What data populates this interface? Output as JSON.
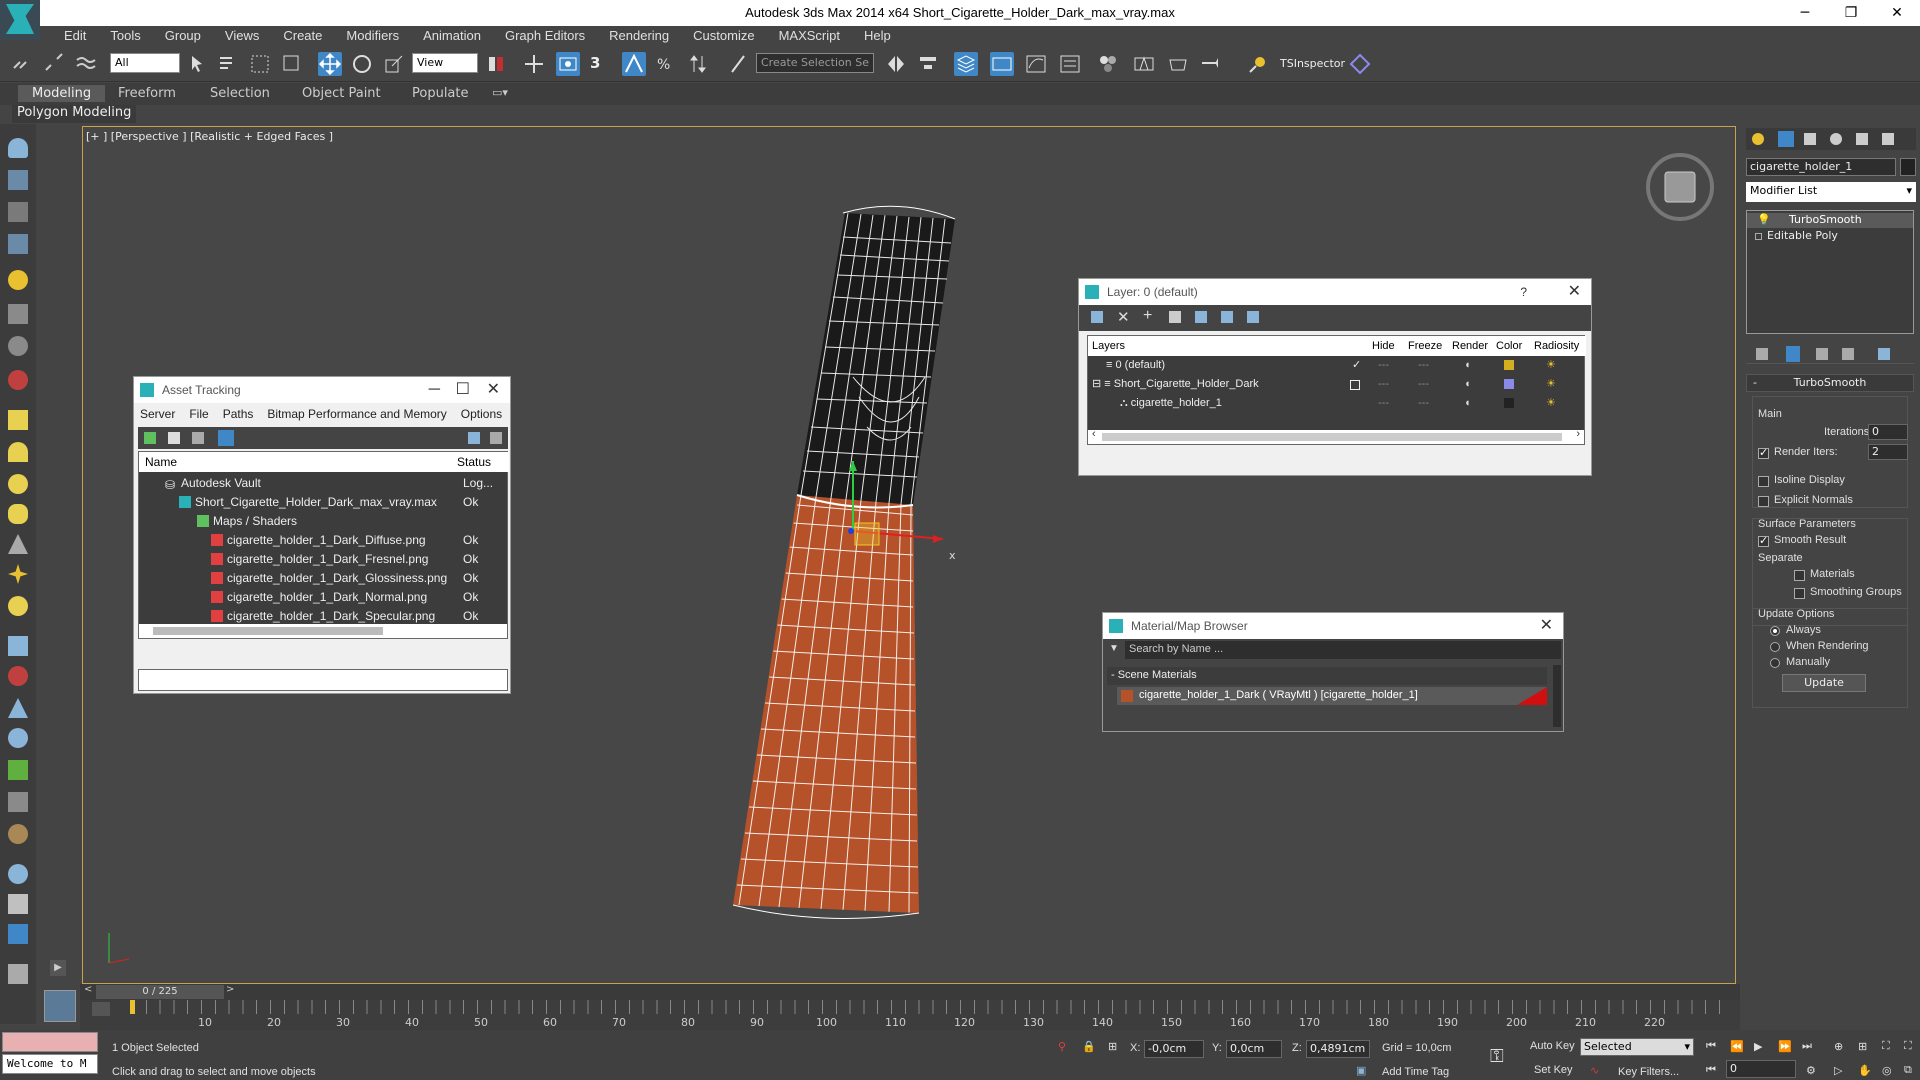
{
  "window": {
    "title": "Autodesk 3ds Max  2014 x64     Short_Cigarette_Holder_Dark_max_vray.max",
    "min": "─",
    "max": "❐",
    "close": "✕"
  },
  "menu": [
    "Edit",
    "Tools",
    "Group",
    "Views",
    "Create",
    "Modifiers",
    "Animation",
    "Graph Editors",
    "Rendering",
    "Customize",
    "MAXScript",
    "Help"
  ],
  "toolbar": {
    "selection_filter": "All",
    "ref_coord": "View",
    "snap_num": "3",
    "named_selection_placeholder": "Create Selection Se",
    "tsinspector": "TSInspector"
  },
  "ribbon": {
    "tabs": [
      "Modeling",
      "Freeform",
      "Selection",
      "Object Paint",
      "Populate"
    ],
    "poly_label": "Polygon Modeling"
  },
  "viewport": {
    "label": "[+ ] [Perspective ] [Realistic + Edged Faces ]",
    "gizmo_x": "x"
  },
  "asset_tracking": {
    "title": "Asset Tracking",
    "menu": [
      "Server",
      "File",
      "Paths",
      "Bitmap Performance and Memory",
      "Options"
    ],
    "col_name": "Name",
    "col_status": "Status",
    "rows": [
      {
        "name": "Autodesk Vault",
        "status": "Log..."
      },
      {
        "name": "Short_Cigarette_Holder_Dark_max_vray.max",
        "status": "Ok"
      },
      {
        "name": "Maps / Shaders",
        "status": ""
      },
      {
        "name": "cigarette_holder_1_Dark_Diffuse.png",
        "status": "Ok"
      },
      {
        "name": "cigarette_holder_1_Dark_Fresnel.png",
        "status": "Ok"
      },
      {
        "name": "cigarette_holder_1_Dark_Glossiness.png",
        "status": "Ok"
      },
      {
        "name": "cigarette_holder_1_Dark_Normal.png",
        "status": "Ok"
      },
      {
        "name": "cigarette_holder_1_Dark_Specular.png",
        "status": "Ok"
      }
    ]
  },
  "layer_panel": {
    "title": "Layer: 0 (default)",
    "help": "?",
    "cols": [
      "Layers",
      "Hide",
      "Freeze",
      "Render",
      "Color",
      "Radiosity"
    ],
    "rows": [
      {
        "name": "0 (default)",
        "color": "#d4b020"
      },
      {
        "name": "Short_Cigarette_Holder_Dark",
        "color": "#8a8ae8"
      },
      {
        "name": "cigarette_holder_1",
        "color": "#222222"
      }
    ]
  },
  "material_browser": {
    "title": "Material/Map Browser",
    "search_placeholder": "Search by Name ...",
    "section": "- Scene Materials",
    "item": "cigarette_holder_1_Dark  ( VRayMtl )  [cigarette_holder_1]"
  },
  "command_panel": {
    "object_name": "cigarette_holder_1",
    "modifier_list": "Modifier List",
    "stack": [
      "TurboSmooth",
      "Editable Poly"
    ],
    "rollout_title": "TurboSmooth",
    "main": "Main",
    "iterations_label": "Iterations:",
    "iterations": "0",
    "render_iters_label": "Render Iters:",
    "render_iters": "2",
    "isoline": "Isoline Display",
    "explicit_normals": "Explicit Normals",
    "surface_params": "Surface Parameters",
    "smooth_result": "Smooth Result",
    "separate": "Separate",
    "materials": "Materials",
    "smoothing_groups": "Smoothing Groups",
    "update_options": "Update Options",
    "always": "Always",
    "when_rendering": "When Rendering",
    "manually": "Manually",
    "update_btn": "Update"
  },
  "timeline": {
    "frame": "0 / 225",
    "ticks": [
      "10",
      "20",
      "30",
      "40",
      "50",
      "60",
      "70",
      "80",
      "90",
      "100",
      "110",
      "120",
      "130",
      "140",
      "150",
      "160",
      "170",
      "180",
      "190",
      "200",
      "210",
      "220"
    ]
  },
  "status": {
    "welcome": "Welcome to M",
    "selected": "1 Object Selected",
    "prompt": "Click and drag to select and move objects",
    "x_label": "X:",
    "x": "-0,0cm",
    "y_label": "Y:",
    "y": "0,0cm",
    "z_label": "Z:",
    "z": "0,4891cm",
    "grid": "Grid = 10,0cm",
    "auto_key": "Auto Key",
    "set_key": "Set Key",
    "key_mode": "Selected",
    "key_filters": "Key Filters...",
    "add_time_tag": "Add Time Tag",
    "frame_field": "0"
  },
  "colors": {
    "accent": "#2ab1b8",
    "wood": "#b5522a",
    "viewport_border": "#c9a34a"
  }
}
